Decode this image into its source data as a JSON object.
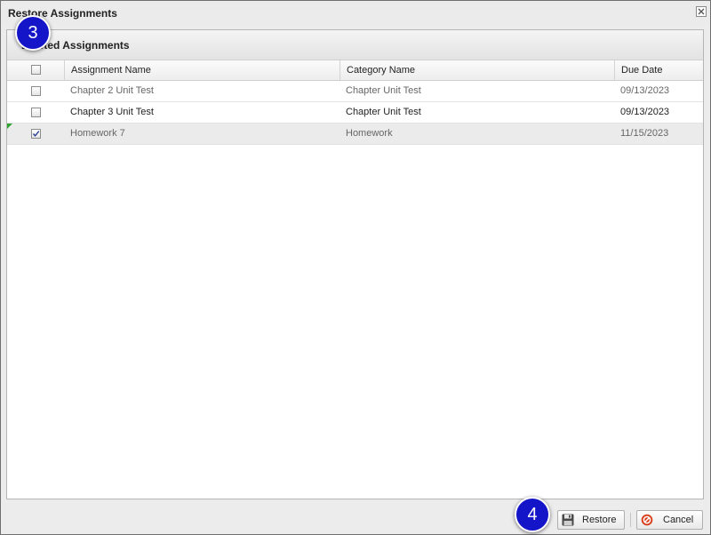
{
  "window": {
    "title": "Restore Assignments"
  },
  "panel": {
    "title": "Deleted Assignments"
  },
  "grid": {
    "columns": [
      "Assignment Name",
      "Category Name",
      "Due Date"
    ],
    "rows": [
      {
        "name": "Chapter 2 Unit Test",
        "category": "Chapter Unit Test",
        "due": "09/13/2023",
        "checked": false
      },
      {
        "name": "Chapter 3 Unit Test",
        "category": "Chapter Unit Test",
        "due": "09/13/2023",
        "checked": false
      },
      {
        "name": "Homework 7",
        "category": "Homework",
        "due": "11/15/2023",
        "checked": true
      }
    ]
  },
  "buttons": {
    "restore": "Restore",
    "cancel": "Cancel"
  },
  "callouts": {
    "step3": "3",
    "step4": "4"
  },
  "icons": {
    "close": "close-icon",
    "save": "floppy-disk-icon",
    "cancel": "no-entry-icon",
    "check": "checkmark-icon"
  },
  "colors": {
    "callout": "#1414c8",
    "cancel_icon": "#d9401e",
    "dirty_marker": "#2ea12e"
  }
}
